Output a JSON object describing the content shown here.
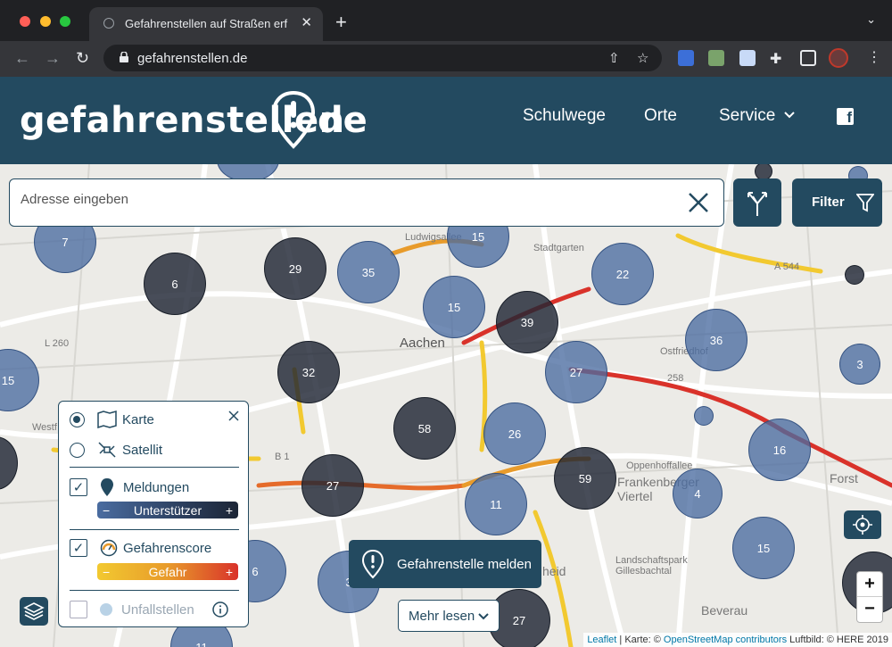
{
  "browser": {
    "tab_title": "Gefahrenstellen auf Straßen erf",
    "new_tab": "+",
    "tab_close": "✕",
    "url": "gefahrenstellen.de"
  },
  "site": {
    "logo_left": "gefahrenstellen",
    "logo_right": "de",
    "nav": [
      "Schulwege",
      "Orte",
      "Service"
    ],
    "facebook": "f"
  },
  "search": {
    "placeholder": "Adresse eingeben",
    "filter_label": "Filter"
  },
  "map": {
    "clusters": [
      "7",
      "6",
      "29",
      "35",
      "15",
      "22",
      "15",
      "39",
      "36",
      "3",
      "15",
      "32",
      "27",
      "58",
      "26",
      "16",
      "27",
      "59",
      "11",
      "4",
      "15",
      "6",
      "3",
      "27",
      "11"
    ],
    "labels": [
      "Aachen",
      "Ludwigsallee",
      "Stadtgarten",
      "A 544",
      "L 260",
      "Ostfriedhof",
      "Westf",
      "B 1",
      "Oppenhoffallee",
      "Frankenberger Viertel",
      "Forst",
      "Landschaftspark Gillesbachtal",
      "Beverau",
      "heid",
      "258",
      "L 260",
      "B 1"
    ]
  },
  "layer_panel": {
    "karte": "Karte",
    "satellit": "Satellit",
    "meldungen": "Meldungen",
    "unterstuetzer": "Unterstützer",
    "gefahrenscore": "Gefahrenscore",
    "gefahr": "Gefahr",
    "unfallstellen": "Unfallstellen",
    "minus": "−",
    "plus": "+"
  },
  "actions": {
    "report": "Gefahrenstelle melden",
    "more": "Mehr lesen",
    "zoom_in": "+",
    "zoom_out": "−"
  },
  "attribution": {
    "leaflet": "Leaflet",
    "karte": "| Karte: ©",
    "osm": "OpenStreetMap contributors",
    "luftbild": "Luftbild: © HERE 2019"
  },
  "colors": {
    "brand": "#234a60",
    "cluster_dark": "#202634",
    "cluster_blue": "#4a6ca0",
    "support_bar": "#4a6ca0",
    "danger_low": "#f2c930",
    "danger_high": "#d9322a"
  }
}
